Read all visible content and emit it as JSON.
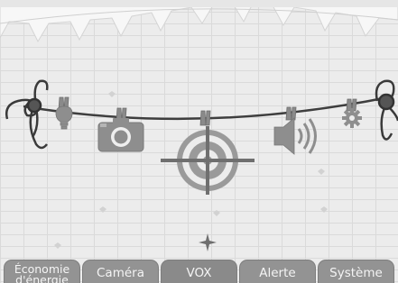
{
  "app": {
    "background": "#ececec",
    "accent_gray": "#8e8e8e"
  },
  "menu": {
    "selected_index": 2,
    "items": [
      {
        "id": "economie",
        "icon": "lightbulb-icon",
        "label": "Économie d'énergie"
      },
      {
        "id": "camera",
        "icon": "camera-icon",
        "label": "Caméra"
      },
      {
        "id": "vox",
        "icon": "target-icon",
        "label": "VOX"
      },
      {
        "id": "alerte",
        "icon": "speaker-icon",
        "label": "Alerte"
      },
      {
        "id": "systeme",
        "icon": "gear-icon",
        "label": "Système"
      }
    ]
  }
}
